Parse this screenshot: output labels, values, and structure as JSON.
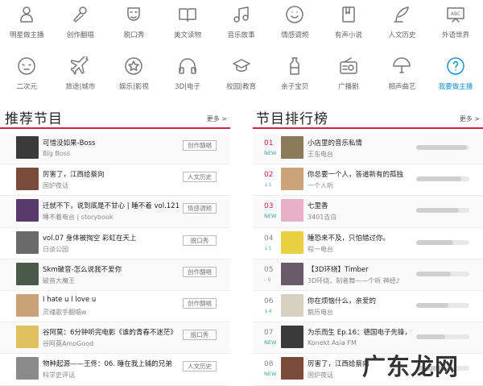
{
  "categories_row1": [
    {
      "label": "明星做主播",
      "icon": "person-icon"
    },
    {
      "label": "创作翻唱",
      "icon": "microphone-icon"
    },
    {
      "label": "脱口秀",
      "icon": "mask-icon"
    },
    {
      "label": "美文读物",
      "icon": "book-icon"
    },
    {
      "label": "音乐故事",
      "icon": "music-note-icon"
    },
    {
      "label": "情感调频",
      "icon": "smile-icon"
    },
    {
      "label": "有声小说",
      "icon": "novel-icon"
    },
    {
      "label": "人文历史",
      "icon": "quill-icon"
    },
    {
      "label": "外语世界",
      "icon": "abc-board-icon"
    }
  ],
  "categories_row2": [
    {
      "label": "二次元",
      "icon": "face-icon"
    },
    {
      "label": "旅途|城市",
      "icon": "airplane-icon"
    },
    {
      "label": "娱乐|影视",
      "icon": "star-icon"
    },
    {
      "label": "3D|电子",
      "icon": "headphones-icon"
    },
    {
      "label": "校园|教育",
      "icon": "graduation-cap-icon"
    },
    {
      "label": "亲子宝贝",
      "icon": "bottle-icon"
    },
    {
      "label": "广播剧",
      "icon": "radio-icon"
    },
    {
      "label": "相声曲艺",
      "icon": "fan-icon"
    },
    {
      "label": "我要做主播",
      "icon": "question-icon",
      "active": true
    }
  ],
  "recommend": {
    "title": "推荐节目",
    "more": "更多 >",
    "items": [
      {
        "title": "可惜没如果-Boss",
        "sub": "Big Boss",
        "tag": "创作翻唱",
        "thumb": "#3a3a3a"
      },
      {
        "title": "厉害了，江西给蔡向",
        "sub": "国炉夜话",
        "tag": "人文历史",
        "thumb": "#7a4a3a"
      },
      {
        "title": "迁就不下，说到底是不甘心 | 睡不着 vol.121",
        "sub": "睡不着电台 | storybook",
        "tag": "情感调频",
        "thumb": "#5a3a6a"
      },
      {
        "title": "vol.07 身体被掏空 彩虹在天上",
        "sub": "日谈公园",
        "tag": "脱口秀",
        "thumb": "#6a6a6a"
      },
      {
        "title": "Skm破音-怎么说我不爱你",
        "sub": "破音大魔王",
        "tag": "创作翻唱",
        "thumb": "#4a5a4a"
      },
      {
        "title": "I hate u I love u",
        "sub": "灵魂歌手翻唱w",
        "tag": "创作翻唱",
        "thumb": "#c9a27a"
      },
      {
        "title": "谷阿莫：6分钟听完电影《谁的青春不迷茫》",
        "sub": "谷阿莫AmoGood",
        "tag": "脱口秀",
        "thumb": "#e0c060"
      },
      {
        "title": "物种起源——王佟：06. 睡在我上铺的兄弟",
        "sub": "科学史评话",
        "tag": "人文历史",
        "thumb": "#8a8a8a"
      }
    ]
  },
  "ranking": {
    "title": "节目排行榜",
    "more": "更多 >",
    "items": [
      {
        "rank": "01",
        "change": "NEW",
        "title": "小店里的音乐私情",
        "sub": "王东电台",
        "thumb": "#8a7a5a",
        "pct": 0.95
      },
      {
        "rank": "02",
        "change": "↓1",
        "title": "你总要一个人，答道新有的孤独",
        "sub": "一个人听",
        "thumb": "#caa37a",
        "pct": 0.85
      },
      {
        "rank": "03",
        "change": "NEW",
        "title": "七里香",
        "sub": "3401吉白",
        "thumb": "#e8b0c8",
        "pct": 0.8
      },
      {
        "rank": "04",
        "change": "↓1",
        "title": "睡恐来不及，只怕错过你。",
        "sub": "程一电台",
        "thumb": "#e8d040",
        "pct": 0.7
      },
      {
        "rank": "05",
        "change": "- 0",
        "title": "【3D环绕】Timber",
        "sub": "3D环绕，制者舞——个听 神经♪",
        "thumb": "#6a5a6a",
        "pct": 0.65
      },
      {
        "rank": "06",
        "change": "↓4",
        "title": "你在烦恼什么，亲爱的",
        "sub": "鹅历电台",
        "thumb": "#d8d0c0",
        "pct": 0.6
      },
      {
        "rank": "07",
        "change": "NEW",
        "title": "为乐而生 Ep.16：德国电子先锋，意...",
        "sub": "Konekt Asia FM",
        "thumb": "#3a3a3a",
        "pct": 0.55
      },
      {
        "rank": "08",
        "change": "NEW",
        "title": "厉害了，江西给蔡向",
        "sub": "国炉夜话",
        "thumb": "#7a4a3a",
        "pct": 0.5
      }
    ]
  },
  "watermark": "广东龙网",
  "colors": {
    "accent": "#d6223a",
    "active_blue": "#1a8fd8"
  }
}
